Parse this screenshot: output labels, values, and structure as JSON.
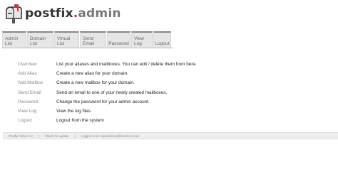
{
  "logo": {
    "name_main": "postfix",
    "name_dot": ".",
    "name_admin": "admin"
  },
  "menu": {
    "items": [
      {
        "label": "Admin List"
      },
      {
        "label": "Domain List"
      },
      {
        "label": "Virtual List"
      },
      {
        "label": "Send Email"
      },
      {
        "label": "Password"
      },
      {
        "label": "View Log"
      },
      {
        "label": "Logout"
      }
    ]
  },
  "overview": {
    "rows": [
      {
        "link": "Overview",
        "description": "List your aliases and mailboxes. You can edit / delete them from here."
      },
      {
        "link": "Add Alias",
        "description": "Create a new alias for your domain."
      },
      {
        "link": "Add Mailbox",
        "description": "Create a new mailbox for your domain."
      },
      {
        "link": "Send Email",
        "description": "Send an email to one of your newly created mailboxes."
      },
      {
        "link": "Password",
        "description": "Change the password for your admin account."
      },
      {
        "link": "View Log",
        "description": "View the log files."
      },
      {
        "link": "Logout",
        "description": "Logout from the system"
      }
    ]
  },
  "footer": {
    "version": "Postfix Admin 2.2",
    "separator": "|",
    "update_link": "Check for update",
    "logged_in": "Logged in as superadmin@linuxbuzz.com"
  },
  "colors": {
    "menu_bg": "#e6e6e6",
    "menu_top_border": "#888888",
    "link_gray": "#888888",
    "logo_dot_red": "#cc3333"
  }
}
